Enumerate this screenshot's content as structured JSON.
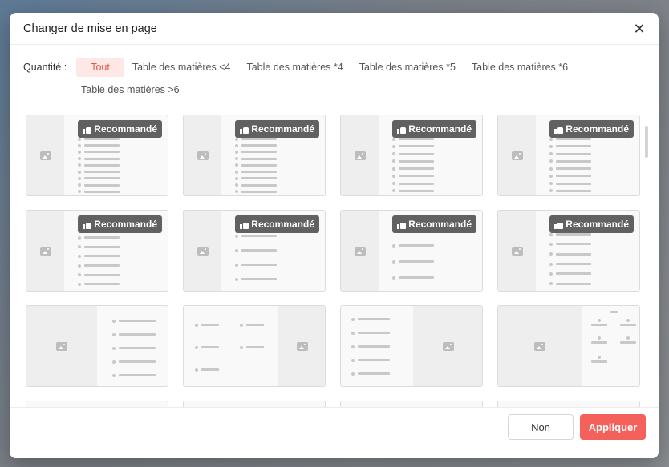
{
  "dialog": {
    "title": "Changer de mise en page",
    "close_icon": "close-icon"
  },
  "filters": {
    "label": "Quantité :",
    "chips": [
      {
        "label": "Tout",
        "active": true
      },
      {
        "label": "Table des matières <4",
        "active": false
      },
      {
        "label": "Table des matières *4",
        "active": false
      },
      {
        "label": "Table des matières *5",
        "active": false
      },
      {
        "label": "Table des matières *6",
        "active": false
      },
      {
        "label": "Table des matières >6",
        "active": false
      }
    ]
  },
  "layouts": {
    "badge_label": "Recommandé",
    "badge_icon": "thumbs-up-icon",
    "image_icon": "image-placeholder-icon"
  },
  "footer": {
    "cancel_label": "Non",
    "apply_label": "Appliquer"
  },
  "colors": {
    "accent": "#f3615a",
    "chip_active_bg": "#fde8e6",
    "chip_active_text": "#e8574a",
    "badge_bg": "#616161"
  }
}
